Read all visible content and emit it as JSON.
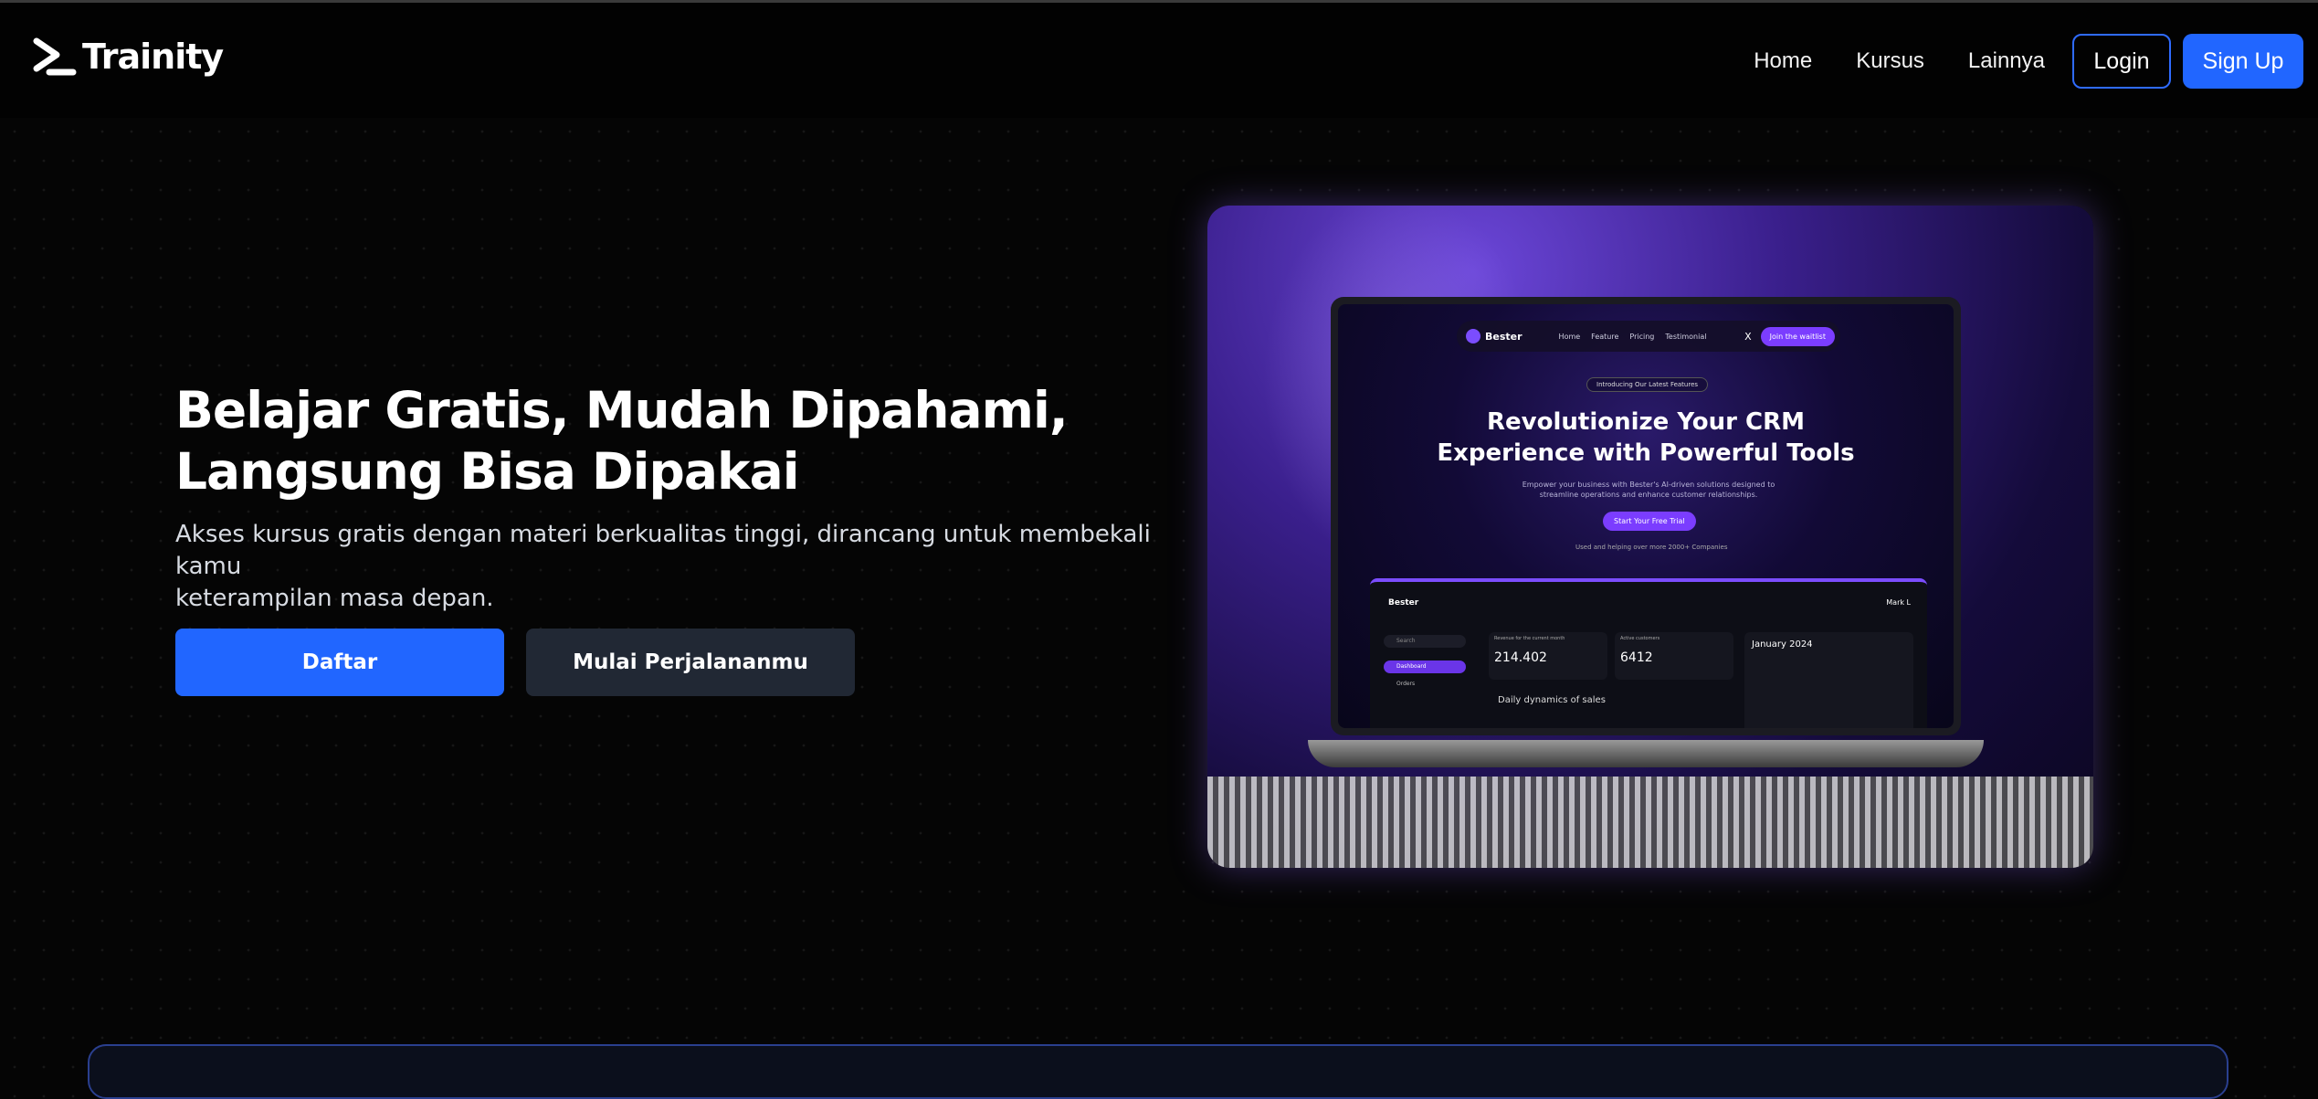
{
  "brand": {
    "name": "Trainity",
    "logo_icon": "chevron-underscore-logo"
  },
  "nav": {
    "links": [
      "Home",
      "Kursus",
      "Lainnya"
    ],
    "login_label": "Login",
    "signup_label": "Sign Up"
  },
  "hero": {
    "title_line1": "Belajar Gratis, Mudah Dipahami,",
    "title_line2": "Langsung Bisa Dipakai",
    "subtitle_line1": "Akses kursus gratis dengan materi berkualitas tinggi, dirancang untuk membekali kamu",
    "subtitle_line2": "keterampilan masa depan.",
    "primary_button": "Daftar",
    "secondary_button": "Mulai Perjalananmu"
  },
  "hero_image": {
    "screen": {
      "brand": "Bester",
      "nav_links": [
        "Home",
        "Feature",
        "Pricing",
        "Testimonial"
      ],
      "nav_x": "X",
      "waitlist_button": "Join the waitlist",
      "badge": "Introducing Our Latest Features",
      "headline_line1": "Revolutionize Your CRM",
      "headline_line2": "Experience with Powerful Tools",
      "description": "Empower your business with Bester's AI-driven solutions designed to streamline operations and enhance customer relationships.",
      "cta": "Start Your Free Trial",
      "used_by": "Used and helping over more 2000+ Companies",
      "dashboard": {
        "brand": "Bester",
        "search": "Search",
        "nav_dashboard": "Dashboard",
        "nav_orders": "Orders",
        "card1_label": "Revenue for the current month",
        "card1_value": "214.402",
        "card2_label": "Active customers",
        "card2_value": "6412",
        "calendar_title": "January 2024",
        "user_name": "Mark L",
        "dynamics_title": "Daily dynamics of sales"
      }
    }
  },
  "colors": {
    "background": "#050505",
    "accent_blue": "#2166ff",
    "secondary_button": "#212834",
    "purple": "#7b3dff"
  }
}
